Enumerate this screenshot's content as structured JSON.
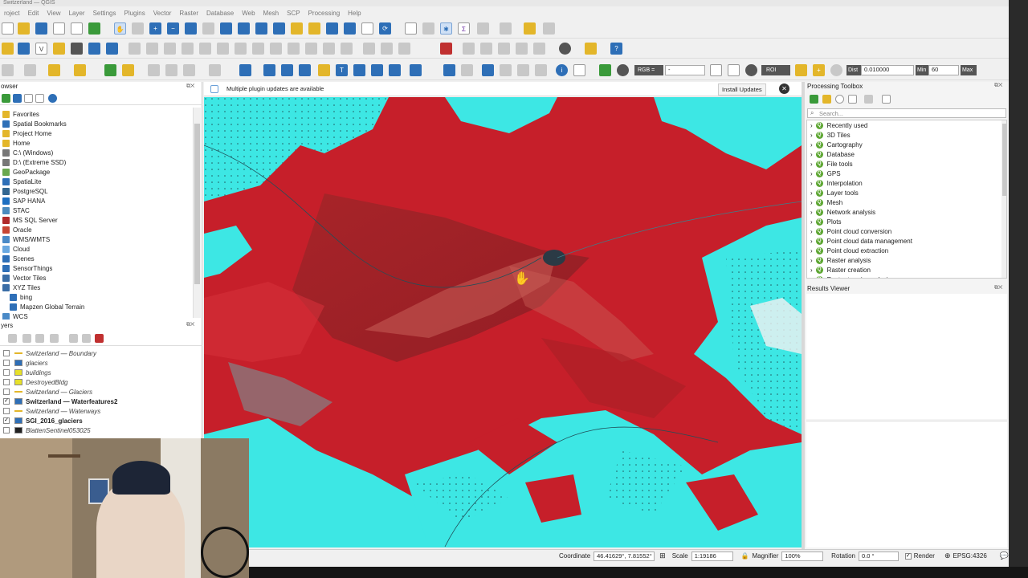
{
  "window": {
    "title": "Switzerland — QGIS"
  },
  "menu": [
    "roject",
    "Edit",
    "View",
    "Layer",
    "Settings",
    "Plugins",
    "Vector",
    "Raster",
    "Database",
    "Web",
    "Mesh",
    "SCP",
    "Processing",
    "Help"
  ],
  "toolbar_scp": {
    "rgb_label": "RGB =",
    "rgb_value": "-",
    "roi_label": "ROI",
    "dist_label": "Dist",
    "dist_value": "0.010000",
    "min_label": "Min",
    "min_value": "60",
    "max_label": "Max"
  },
  "browser": {
    "title": "owser",
    "items": [
      "Favorites",
      "Spatial Bookmarks",
      "Project Home",
      "Home",
      "C:\\ (Windows)",
      "D:\\ (Extreme SSD)",
      "GeoPackage",
      "SpatiaLite",
      "PostgreSQL",
      "SAP HANA",
      "STAC",
      "MS SQL Server",
      "Oracle",
      "WMS/WMTS",
      "Cloud",
      "Scenes",
      "SensorThings",
      "Vector Tiles",
      "XYZ Tiles",
      "bing",
      "Mapzen Global Terrain",
      "WCS"
    ]
  },
  "layers": {
    "title": "yers",
    "items": [
      {
        "name": "Switzerland — Boundary",
        "checked": false,
        "style": "italic"
      },
      {
        "name": "glaciers",
        "checked": false,
        "style": "italic"
      },
      {
        "name": "buildings",
        "checked": false,
        "style": "italic"
      },
      {
        "name": "DestroyedBldg",
        "checked": false,
        "style": "italic"
      },
      {
        "name": "Switzerland — Glaciers",
        "checked": false,
        "style": "italic"
      },
      {
        "name": "Switzerland — Waterfeatures2",
        "checked": true,
        "style": "bold"
      },
      {
        "name": "Switzerland — Waterways",
        "checked": false,
        "style": "italic"
      },
      {
        "name": "SGI_2016_glaciers",
        "checked": true,
        "style": "bold"
      },
      {
        "name": "BlattenSentinel053025",
        "checked": false,
        "style": "italic"
      }
    ]
  },
  "message_bar": {
    "text": "Multiple plugin updates are available",
    "action": "Install Updates",
    "close": "✕"
  },
  "processing": {
    "title": "Processing Toolbox",
    "search_placeholder": "Search...",
    "items": [
      "Recently used",
      "3D Tiles",
      "Cartography",
      "Database",
      "File tools",
      "GPS",
      "Interpolation",
      "Layer tools",
      "Mesh",
      "Network analysis",
      "Plots",
      "Point cloud conversion",
      "Point cloud data management",
      "Point cloud extraction",
      "Raster analysis",
      "Raster creation",
      "Raster terrain analysis"
    ]
  },
  "results_viewer": {
    "title": "Results Viewer"
  },
  "statusbar": {
    "coordinate_label": "Coordinate",
    "coordinate_value": "46.41629°, 7.81552°",
    "scale_label": "Scale",
    "scale_value": "1:19186",
    "magnifier_label": "Magnifier",
    "magnifier_value": "100%",
    "rotation_label": "Rotation",
    "rotation_value": "0.0 °",
    "render_label": "Render",
    "crs": "EPSG:4326"
  },
  "colors": {
    "map_red": "#c61f2a",
    "map_cyan": "#3de7e4",
    "accent_blue": "#2e6fb7",
    "qgis_green": "#5da632"
  }
}
